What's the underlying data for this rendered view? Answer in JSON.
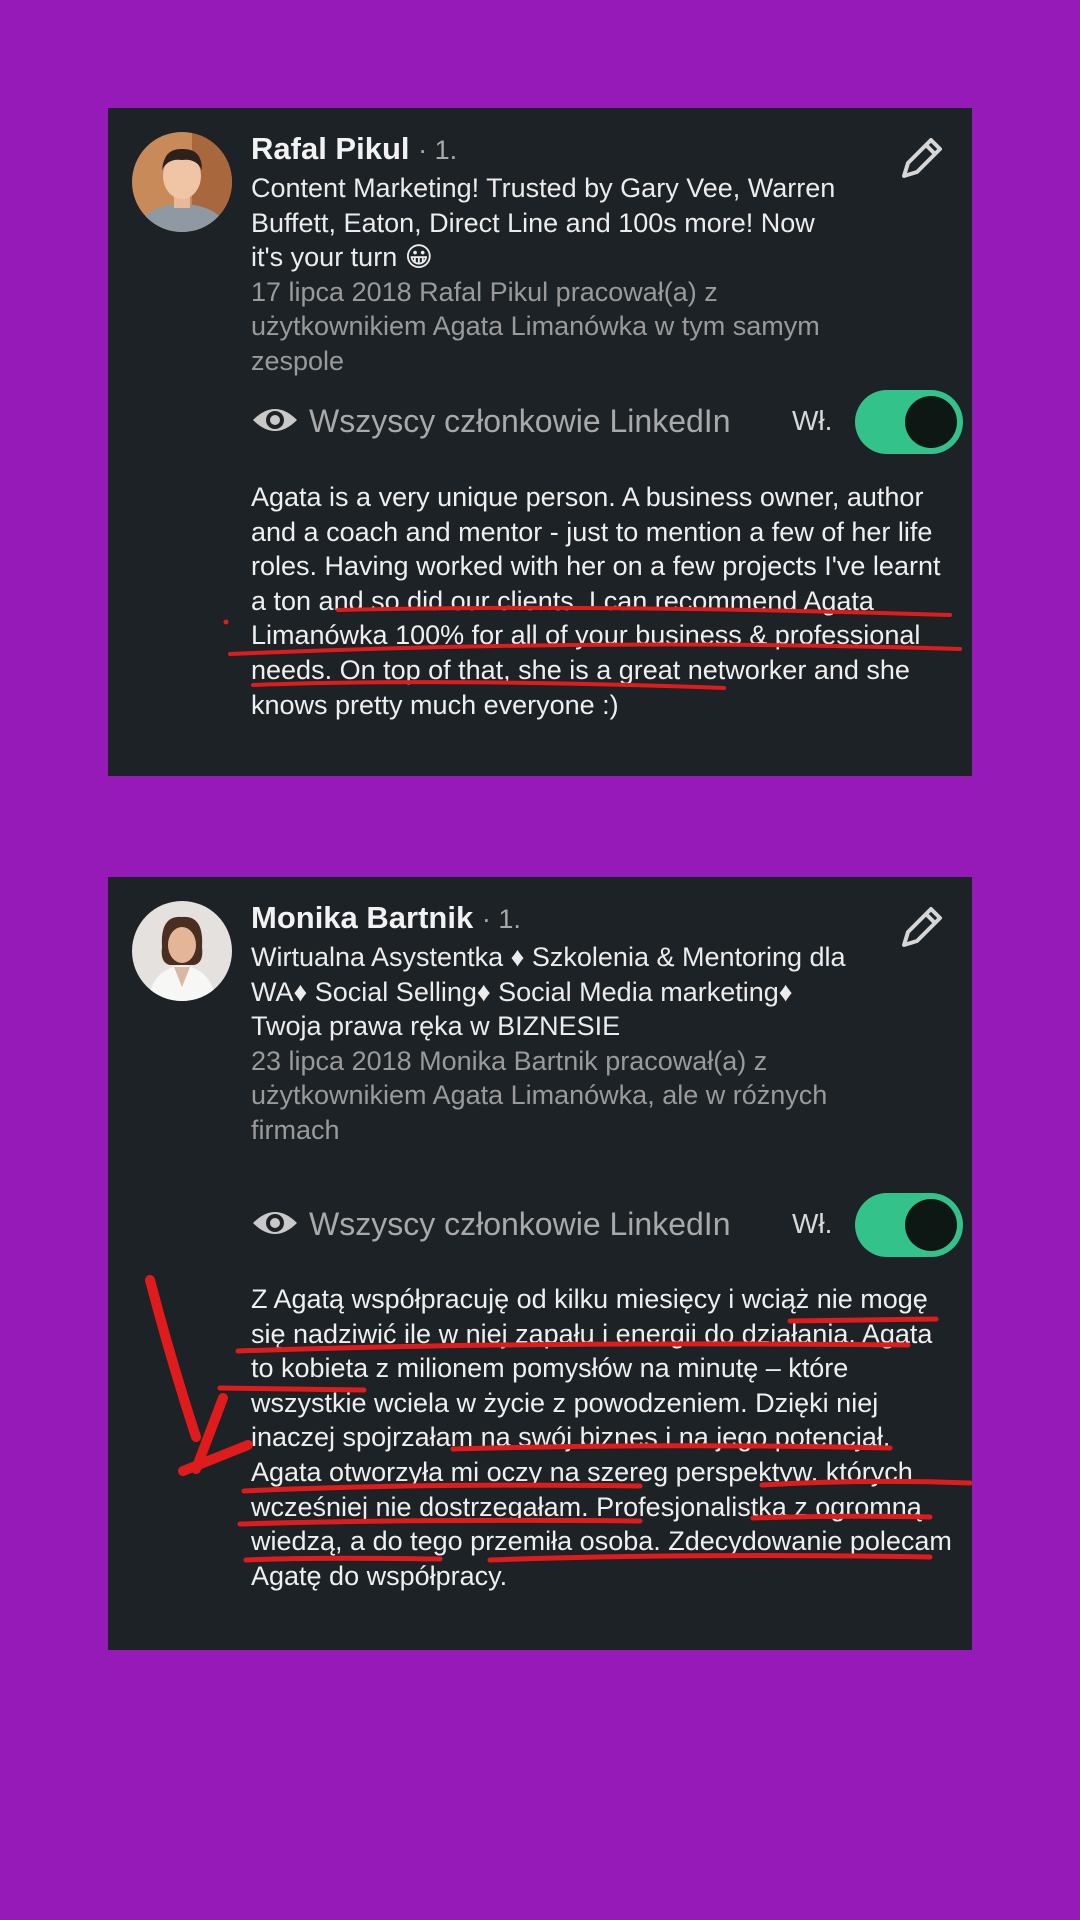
{
  "cards": [
    {
      "name": "Rafal Pikul",
      "degree": "· 1.",
      "headline": "Content Marketing! Trusted by Gary Vee, Warren Buffett, Eaton, Direct Line and 100s more! Now it's your turn 😀",
      "meta": "17 lipca 2018 Rafal Pikul pracował(a) z użytkownikiem Agata Limanówka w tym samym zespole",
      "visibility": "Wszyscy członkowie LinkedIn",
      "toggle_label": "Wł.",
      "toggle_on": true,
      "recommendation": "Agata is a very unique person. A business owner, author and a coach and mentor - just to mention a few of her life roles. Having worked with her on a few projects I've learnt a ton and so did our clients. I can recommend Agata Limanówka 100% for all of your business & professional needs. On top of that, she is a great networker and she knows pretty much everyone :)"
    },
    {
      "name": "Monika Bartnik",
      "degree": "· 1.",
      "headline": "Wirtualna Asystentka ♦ Szkolenia & Mentoring dla WA♦ Social Selling♦ Social Media  marketing♦ Twoja prawa ręka w BIZNESIE",
      "meta": "23 lipca 2018 Monika Bartnik pracował(a) z użytkownikiem Agata Limanówka, ale w różnych firmach",
      "visibility": "Wszyscy członkowie LinkedIn",
      "toggle_label": "Wł.",
      "toggle_on": true,
      "recommendation": "Z Agatą współpracuję od kilku miesięcy i wciąż nie mogę się nadziwić ile w niej zapału i energii do działania. Agata to kobieta z milionem pomysłów na minutę – które wszystkie wciela w życie z powodzeniem. Dzięki niej inaczej spojrzałam na swój biznes i na jego potencjał. Agata otworzyła mi oczy na szereg perspektyw, których wcześniej nie dostrzegałam. Profesjonalistka z ogromną wiedzą, a do tego przemiła osoba.  Zdecydowanie polecam Agatę do współpracy."
    }
  ],
  "colors": {
    "background": "#961ab8",
    "card": "#1d2226",
    "toggle": "#33c28a",
    "annotation": "#e01b1b"
  },
  "icons": [
    "pencil-icon",
    "eye-icon"
  ]
}
